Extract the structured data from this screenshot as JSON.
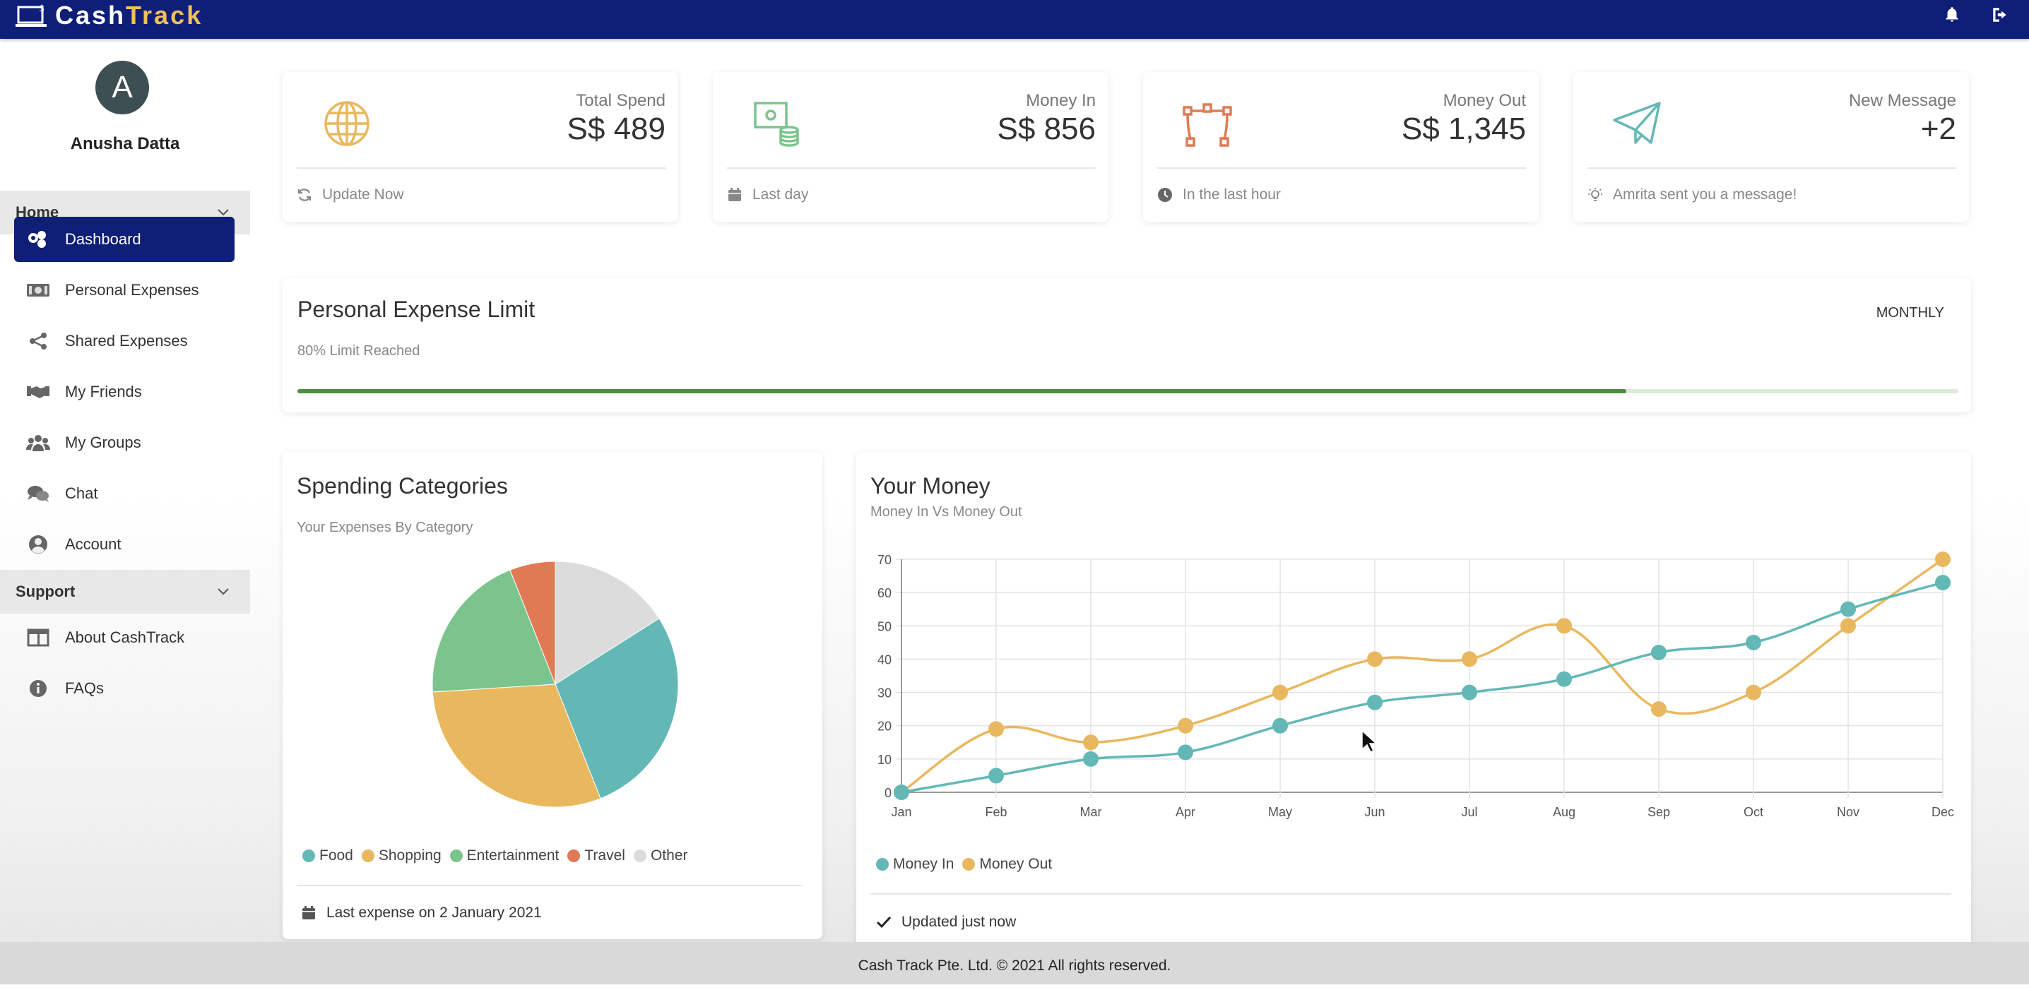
{
  "app": {
    "brand_part1": "Cash",
    "brand_part2": "Track"
  },
  "user": {
    "initial": "A",
    "name": "Anusha Datta"
  },
  "sidebar": {
    "sections": [
      {
        "label": "Home"
      },
      {
        "label": "Support"
      }
    ],
    "items": [
      {
        "label": "Dashboard",
        "icon": "dashboard-icon"
      },
      {
        "label": "Personal Expenses",
        "icon": "money-bill-icon"
      },
      {
        "label": "Shared Expenses",
        "icon": "share-icon"
      },
      {
        "label": "My Friends",
        "icon": "handshake-icon"
      },
      {
        "label": "My Groups",
        "icon": "users-icon"
      },
      {
        "label": "Chat",
        "icon": "chat-icon"
      },
      {
        "label": "Account",
        "icon": "account-icon"
      },
      {
        "label": "About CashTrack",
        "icon": "columns-icon"
      },
      {
        "label": "FAQs",
        "icon": "info-icon"
      }
    ]
  },
  "stats": [
    {
      "label": "Total Spend",
      "value": "S$ 489",
      "footer": "Update Now",
      "icon": "globe-icon",
      "foot_icon": "refresh-icon"
    },
    {
      "label": "Money In",
      "value": "S$ 856",
      "footer": "Last day",
      "icon": "money-stack-icon",
      "foot_icon": "calendar-icon"
    },
    {
      "label": "Money Out",
      "value": "S$ 1,345",
      "footer": "In the last hour",
      "icon": "bezier-curve-icon",
      "foot_icon": "clock-icon"
    },
    {
      "label": "New Message",
      "value": "+2",
      "footer": "Amrita sent you a message!",
      "icon": "paper-plane-icon",
      "foot_icon": "lightbulb-icon"
    }
  ],
  "limit": {
    "title": "Personal Expense Limit",
    "subtitle": "80% Limit Reached",
    "period": "MONTHLY",
    "progress": 0.8
  },
  "categories": {
    "title": "Spending Categories",
    "subtitle": "Your Expenses By Category",
    "footer": "Last expense on 2 January 2021"
  },
  "money": {
    "title": "Your Money",
    "subtitle": "Money In Vs Money Out",
    "footer": "Updated just now"
  },
  "footer": {
    "text": "Cash Track Pte. Ltd. © 2021 All rights reserved."
  },
  "colors": {
    "nav": "#0f1e77",
    "brand_accent": "#f0c15a",
    "teal": "#63b8b6",
    "gold": "#e9b85e",
    "green": "#7cc48d",
    "orange": "#e07a55",
    "grey": "#dcdcdc"
  },
  "chart_data": [
    {
      "type": "pie",
      "categories": [
        "Food",
        "Shopping",
        "Entertainment",
        "Travel",
        "Other"
      ],
      "values": [
        28,
        30,
        20,
        6,
        16
      ],
      "colors": [
        "#63b8b6",
        "#e9b85e",
        "#7cc48d",
        "#e07a55",
        "#dcdcdc"
      ],
      "legend": "bottom"
    },
    {
      "type": "line",
      "x": [
        "Jan",
        "Feb",
        "Mar",
        "Apr",
        "May",
        "Jun",
        "Jul",
        "Aug",
        "Sep",
        "Oct",
        "Nov",
        "Dec"
      ],
      "series": [
        {
          "name": "Money In",
          "color": "#63b8b6",
          "values": [
            0,
            5,
            10,
            12,
            20,
            27,
            30,
            34,
            42,
            45,
            55,
            63
          ]
        },
        {
          "name": "Money Out",
          "color": "#e9b85e",
          "values": [
            0,
            19,
            15,
            20,
            30,
            40,
            40,
            50,
            25,
            30,
            50,
            70
          ]
        }
      ],
      "yticks": [
        0,
        10,
        20,
        30,
        40,
        50,
        60,
        70
      ],
      "ylim": [
        0,
        70
      ],
      "grid": true,
      "legend": "bottom-left"
    }
  ]
}
